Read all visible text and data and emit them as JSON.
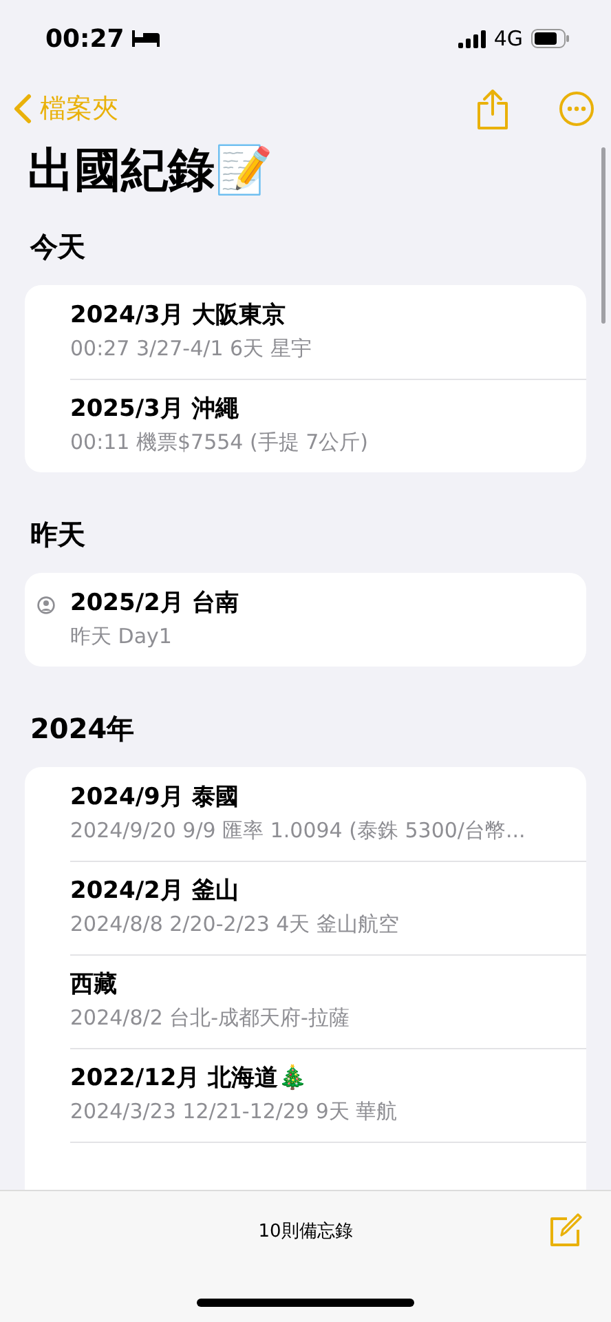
{
  "status_bar": {
    "time": "00:27",
    "network": "4G"
  },
  "nav": {
    "back_label": "檔案夾"
  },
  "title": "出國紀錄📝",
  "sections": [
    {
      "header": "今天",
      "notes": [
        {
          "title": "2024/3月 大阪東京",
          "subtitle": "00:27  3/27-4/1 6天 星宇",
          "shared": false
        },
        {
          "title": "2025/3月 沖繩",
          "subtitle": "00:11  機票$7554 (手提 7公斤)",
          "shared": false
        }
      ]
    },
    {
      "header": "昨天",
      "notes": [
        {
          "title": "2025/2月 台南",
          "subtitle": "昨天  Day1",
          "shared": true
        }
      ]
    },
    {
      "header": "2024年",
      "notes": [
        {
          "title": "2024/9月 泰國",
          "subtitle": "2024/9/20  9/9 匯率 1.0094 (泰銖 5300/台幣...",
          "shared": false
        },
        {
          "title": "2024/2月 釜山",
          "subtitle": "2024/8/8  2/20-2/23 4天 釜山航空",
          "shared": false
        },
        {
          "title": "西藏",
          "subtitle": "2024/8/2  台北-成都天府-拉薩",
          "shared": false
        },
        {
          "title": "2022/12月 北海道🎄",
          "subtitle": "2024/3/23  12/21-12/29 9天 華航",
          "shared": false
        }
      ]
    }
  ],
  "toolbar": {
    "count": "10則備忘錄"
  }
}
